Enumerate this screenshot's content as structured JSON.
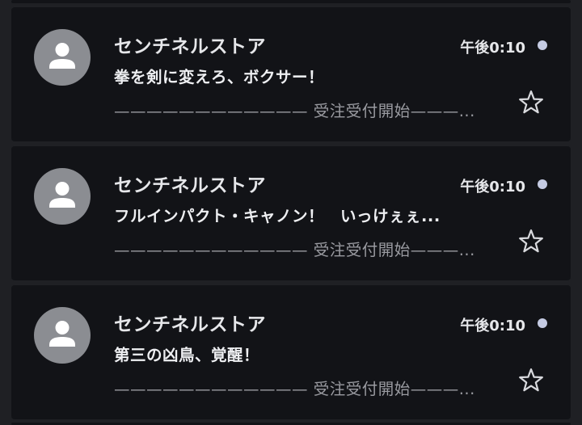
{
  "messages": [
    {
      "sender": "センチネルストア",
      "time": "午後0:10",
      "subject": "拳を剣に変えろ、ボクサー！",
      "preview": "———————————— 受注受付開始———..."
    },
    {
      "sender": "センチネルストア",
      "time": "午後0:10",
      "subject": "フルインパクト・キャノン！　いっけぇぇ...",
      "preview": "———————————— 受注受付開始———..."
    },
    {
      "sender": "センチネルストア",
      "time": "午後0:10",
      "subject": "第三の凶鳥、覚醒！",
      "preview": "———————————— 受注受付開始———..."
    }
  ],
  "colors": {
    "background": "#1f2024",
    "card": "#121317",
    "avatar": "#8b8d92",
    "unread_dot": "#c5cbe3",
    "text_primary": "#e6e7ea",
    "text_secondary": "#9a9ba1"
  },
  "icons": {
    "avatar": "person-icon",
    "star": "star-outline-icon",
    "unread": "unread-dot-icon"
  }
}
